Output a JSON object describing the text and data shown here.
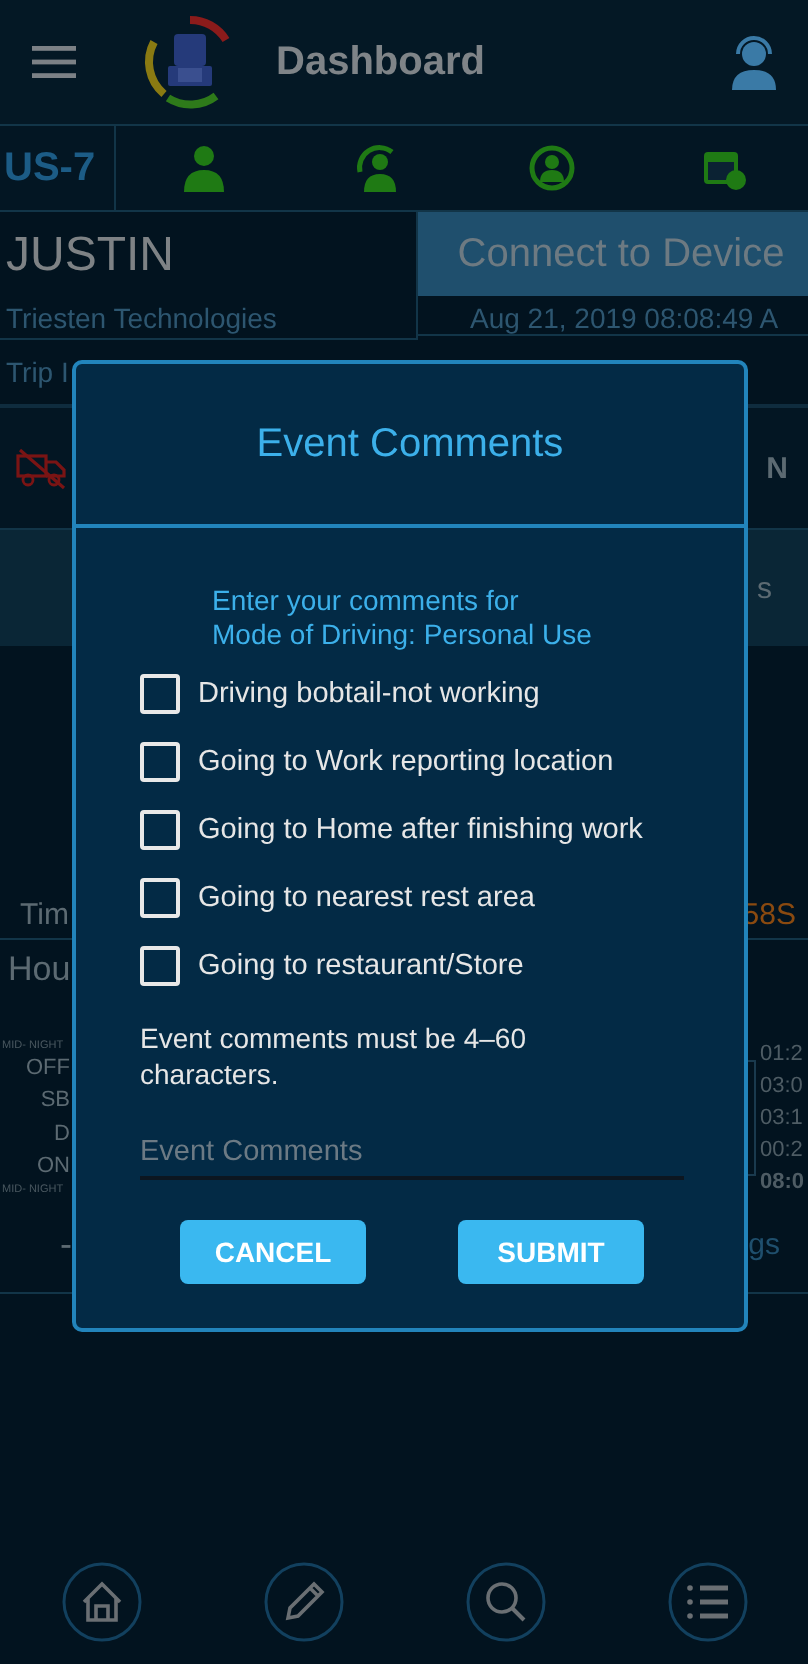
{
  "header": {
    "title": "Dashboard"
  },
  "mode_bar": {
    "ruleset": "US-7"
  },
  "driver": {
    "name": "JUSTIN",
    "company": "Triesten Technologies",
    "trip_label": "Trip I"
  },
  "device": {
    "button": "Connect to Device",
    "datetime": "Aug 21, 2019 08:08:49 A"
  },
  "status_row": {
    "text": "N"
  },
  "tabs_row": {
    "text": "s"
  },
  "timer": {
    "label": "Tim",
    "value": "58S"
  },
  "hours": {
    "label": "Hou"
  },
  "log_chart": {
    "top_label": "MID- NIGHT",
    "row_labels": [
      "OFF",
      "SB",
      "D",
      "ON"
    ],
    "bottom_label": "MID- NIGHT",
    "totals": [
      "01:2",
      "03:0",
      "03:1",
      "00:2"
    ],
    "total": "08:0"
  },
  "footer_row": {
    "left": "-",
    "right": "gs"
  },
  "dialog": {
    "title": "Event Comments",
    "prompt": "Enter your comments for\nMode of Driving: Personal Use",
    "options": [
      {
        "label": "Driving bobtail-not working",
        "checked": false
      },
      {
        "label": "Going to Work reporting location",
        "checked": false
      },
      {
        "label": "Going to Home after finishing work",
        "checked": false
      },
      {
        "label": "Going to nearest rest area",
        "checked": false
      },
      {
        "label": "Going to restaurant/Store",
        "checked": false
      }
    ],
    "hint": "Event comments must be 4–60 characters.",
    "field": {
      "placeholder": "Event Comments"
    },
    "buttons": [
      {
        "label": "CANCEL"
      },
      {
        "label": "SUBMIT"
      }
    ]
  }
}
